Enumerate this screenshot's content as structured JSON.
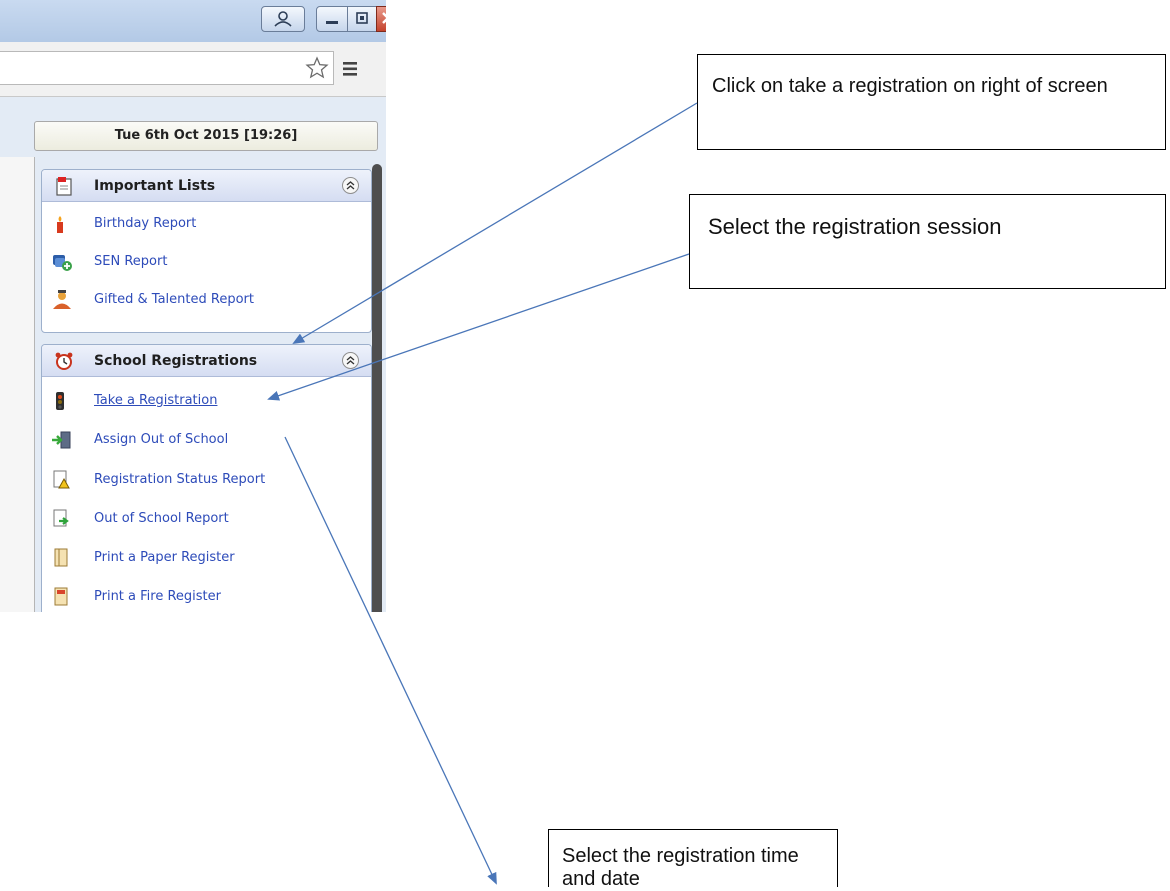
{
  "browser": {
    "menu_icon": "hamburger-menu-icon",
    "bookmark_icon": "star-icon"
  },
  "app": {
    "datetime": "Tue 6th Oct 2015 [19:26]",
    "panels": [
      {
        "title": "Important Lists",
        "icon": "clipboard-icon",
        "items": [
          {
            "label": "Birthday Report",
            "icon": "candle-icon"
          },
          {
            "label": "SEN Report",
            "icon": "users-plus-icon"
          },
          {
            "label": "Gifted & Talented Report",
            "icon": "student-icon"
          }
        ]
      },
      {
        "title": "School Registrations",
        "icon": "alarm-clock-icon",
        "items": [
          {
            "label": "Take a Registration",
            "icon": "traffic-light-icon"
          },
          {
            "label": "Assign Out of School",
            "icon": "exit-door-icon"
          },
          {
            "label": "Registration Status Report",
            "icon": "warning-document-icon"
          },
          {
            "label": "Out of School Report",
            "icon": "green-arrow-document-icon"
          },
          {
            "label": "Print a Paper Register",
            "icon": "register-book-icon"
          },
          {
            "label": "Print a Fire Register",
            "icon": "fire-register-icon"
          }
        ]
      }
    ]
  },
  "annotations": {
    "callout_1": "Click on take a registration on right of screen",
    "callout_2": "Select the registration session",
    "callout_3": "Select the registration time and date",
    "arrow_color": "#4a76b8"
  }
}
